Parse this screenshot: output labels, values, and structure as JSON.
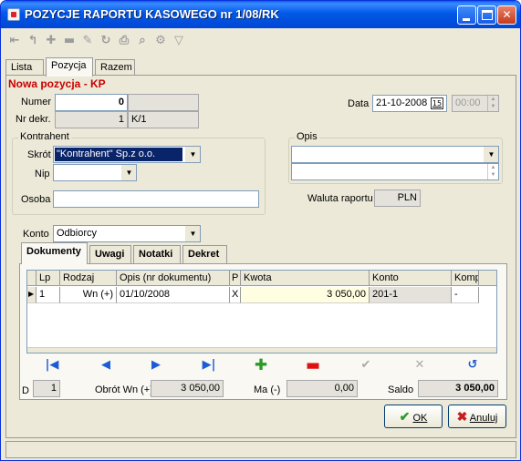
{
  "window": {
    "title": "POZYCJE RAPORTU KASOWEGO nr 1/08/RK"
  },
  "toolbar": {
    "icons": [
      "first-record-icon",
      "prev-record-icon",
      "add-record-icon",
      "delete-record-icon",
      "edit-record-icon",
      "refresh-icon",
      "print-icon",
      "find-icon",
      "tools-icon",
      "filter-icon"
    ]
  },
  "tabs": {
    "lista": "Lista",
    "pozycja": "Pozycja",
    "razem": "Razem"
  },
  "header": {
    "title": "Nowa pozycja - KP"
  },
  "numer": {
    "label": "Numer",
    "value": "0"
  },
  "nrdekr": {
    "label": "Nr dekr.",
    "value": "1",
    "suffix": "K/1"
  },
  "data": {
    "label": "Data",
    "value": "21-10-2008",
    "cal_btn": "15",
    "time": "00:00"
  },
  "kontrahent": {
    "group": "Kontrahent",
    "skrot_label": "Skrót",
    "skrot_value": "\"Kontrahent\" Sp.z o.o.",
    "nip_label": "Nip",
    "nip_value": "",
    "osoba_label": "Osoba",
    "osoba_value": ""
  },
  "opis": {
    "group": "Opis",
    "value": ""
  },
  "waluta": {
    "label": "Waluta raportu",
    "value": "PLN"
  },
  "konto": {
    "label": "Konto",
    "value": "Odbiorcy"
  },
  "subtabs": [
    "Dokumenty",
    "Uwagi",
    "Notatki",
    "Dekret"
  ],
  "table": {
    "columns": [
      "Lp",
      "Rodzaj",
      "Opis (nr dokumentu)",
      "P",
      "Kwota",
      "Konto",
      "Komp"
    ],
    "rows": [
      [
        "1",
        "Wn (+)",
        "01/10/2008",
        "X",
        "3 050,00",
        "201-1",
        "-"
      ]
    ]
  },
  "nav": {
    "first": "first-icon",
    "prev": "prev-icon",
    "next": "next-icon",
    "last": "last-icon",
    "add": "plus-icon",
    "remove": "minus-icon",
    "confirm": "check-icon",
    "cancel": "cross-icon",
    "refresh": "refresh-icon"
  },
  "summary": {
    "d_label": "D",
    "d_value": "1",
    "obrot_label": "Obrót Wn (+)",
    "obrot_value": "3 050,00",
    "ma_label": "Ma (-)",
    "ma_value": "0,00",
    "saldo_label": "Saldo",
    "saldo_value": "3 050,00"
  },
  "buttons": {
    "ok": "OK",
    "anuluj": "Anuluj"
  },
  "colors": {
    "titlebar": "#0058e6",
    "red_title": "#cc0000",
    "selection": "#0a246a",
    "kwota_bg": "#fffee0",
    "ok_green": "#2a9a2a",
    "cancel_red": "#c81e1e"
  }
}
